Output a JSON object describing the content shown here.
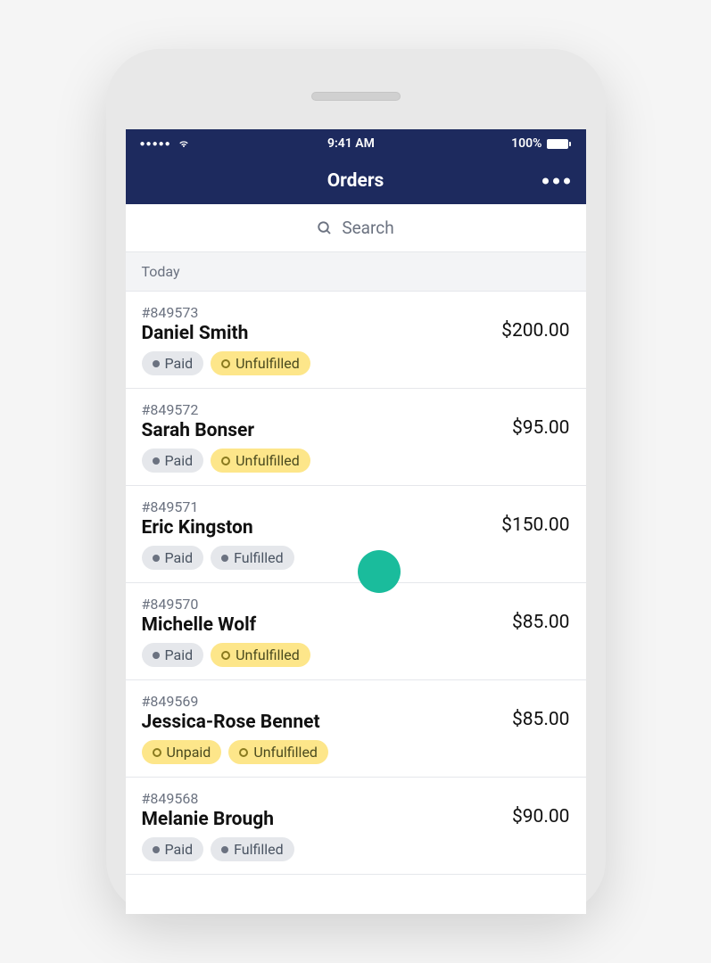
{
  "status_bar": {
    "time": "9:41 AM",
    "battery_percent": "100%"
  },
  "nav": {
    "title": "Orders"
  },
  "search": {
    "placeholder": "Search"
  },
  "section": {
    "header": "Today"
  },
  "orders": [
    {
      "number": "#849573",
      "name": "Daniel Smith",
      "amount": "$200.00",
      "badges": [
        {
          "type": "gray",
          "label": "Paid"
        },
        {
          "type": "yellow",
          "label": "Unfulfilled"
        }
      ]
    },
    {
      "number": "#849572",
      "name": "Sarah Bonser",
      "amount": "$95.00",
      "badges": [
        {
          "type": "gray",
          "label": "Paid"
        },
        {
          "type": "yellow",
          "label": "Unfulfilled"
        }
      ]
    },
    {
      "number": "#849571",
      "name": "Eric Kingston",
      "amount": "$150.00",
      "badges": [
        {
          "type": "gray",
          "label": "Paid"
        },
        {
          "type": "gray",
          "label": "Fulfilled"
        }
      ]
    },
    {
      "number": "#849570",
      "name": "Michelle Wolf",
      "amount": "$85.00",
      "badges": [
        {
          "type": "gray",
          "label": "Paid"
        },
        {
          "type": "yellow",
          "label": "Unfulfilled"
        }
      ]
    },
    {
      "number": "#849569",
      "name": "Jessica-Rose Bennet",
      "amount": "$85.00",
      "badges": [
        {
          "type": "yellow",
          "label": "Unpaid"
        },
        {
          "type": "yellow",
          "label": "Unfulfilled"
        }
      ]
    },
    {
      "number": "#849568",
      "name": "Melanie Brough",
      "amount": "$90.00",
      "badges": [
        {
          "type": "gray",
          "label": "Paid"
        },
        {
          "type": "gray",
          "label": "Fulfilled"
        }
      ]
    }
  ]
}
